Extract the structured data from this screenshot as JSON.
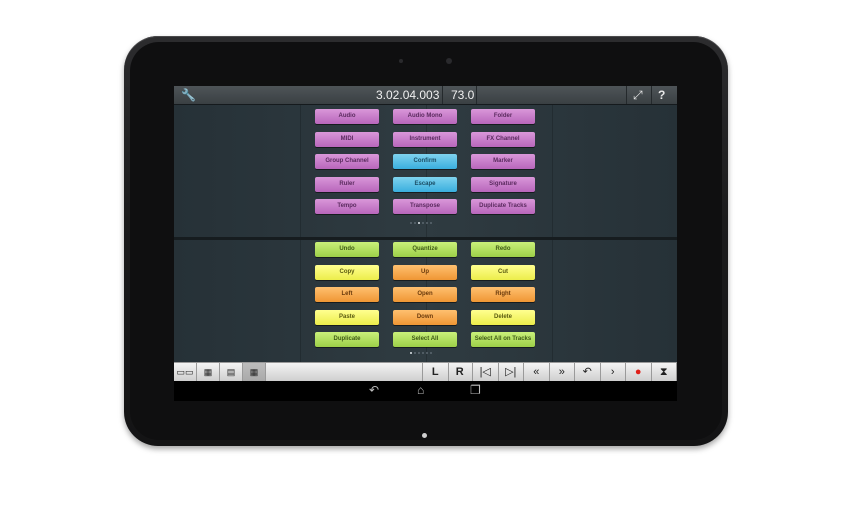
{
  "header": {
    "settings_icon": "wrench-icon",
    "position": "3.02.04.003",
    "tempo": "73.0",
    "expand_icon": "expand-icon",
    "help_label": "?"
  },
  "upper_panel": {
    "rows": [
      [
        {
          "label": "Audio",
          "color": "purple"
        },
        {
          "label": "Audio Mono",
          "color": "purple"
        },
        {
          "label": "Folder",
          "color": "purple"
        }
      ],
      [
        {
          "label": "MIDI",
          "color": "purple"
        },
        {
          "label": "Instrument",
          "color": "purple"
        },
        {
          "label": "FX Channel",
          "color": "purple"
        }
      ],
      [
        {
          "label": "Group Channel",
          "color": "purple"
        },
        {
          "label": "Confirm",
          "color": "cyan"
        },
        {
          "label": "Marker",
          "color": "purple"
        }
      ],
      [
        {
          "label": "Ruler",
          "color": "purple"
        },
        {
          "label": "Escape",
          "color": "cyan"
        },
        {
          "label": "Signature",
          "color": "purple"
        }
      ],
      [
        {
          "label": "Tempo",
          "color": "purple"
        },
        {
          "label": "Transpose",
          "color": "purple"
        },
        {
          "label": "Duplicate Tracks",
          "color": "purple"
        }
      ]
    ],
    "page_count": 6,
    "active_page": 2
  },
  "lower_panel": {
    "rows": [
      [
        {
          "label": "Undo",
          "color": "green"
        },
        {
          "label": "Quantize",
          "color": "green"
        },
        {
          "label": "Redo",
          "color": "green"
        }
      ],
      [
        {
          "label": "Copy",
          "color": "yellow"
        },
        {
          "label": "Up",
          "color": "orange"
        },
        {
          "label": "Cut",
          "color": "yellow"
        }
      ],
      [
        {
          "label": "Left",
          "color": "orange"
        },
        {
          "label": "Open",
          "color": "orange"
        },
        {
          "label": "Right",
          "color": "orange"
        }
      ],
      [
        {
          "label": "Paste",
          "color": "yellow"
        },
        {
          "label": "Down",
          "color": "orange"
        },
        {
          "label": "Delete",
          "color": "yellow"
        }
      ],
      [
        {
          "label": "Duplicate",
          "color": "green"
        },
        {
          "label": "Select All",
          "color": "green"
        },
        {
          "label": "Select All on Tracks",
          "color": "green"
        }
      ]
    ],
    "page_count": 6,
    "active_page": 0
  },
  "toolbar": {
    "layout_buttons": [
      "layout-1-icon",
      "layout-2-icon",
      "layout-3-icon",
      "layout-4-icon"
    ],
    "selected_layout": 3,
    "transport": [
      {
        "label": "L",
        "name": "left-locator-button"
      },
      {
        "label": "R",
        "name": "right-locator-button"
      },
      {
        "label": "|◁",
        "name": "go-to-start-button"
      },
      {
        "label": "▷|",
        "name": "go-to-end-button"
      },
      {
        "label": "«",
        "name": "rewind-button"
      },
      {
        "label": "»",
        "name": "fast-forward-button"
      },
      {
        "label": "↶",
        "name": "cycle-button"
      },
      {
        "label": "›",
        "name": "play-button"
      },
      {
        "label": "●",
        "name": "record-button"
      },
      {
        "label": "⧗",
        "name": "metronome-button"
      }
    ],
    "colors": {
      "record": "#e0201a"
    }
  },
  "system_nav": {
    "back": "back-icon",
    "home": "home-icon",
    "recents": "recents-icon"
  }
}
